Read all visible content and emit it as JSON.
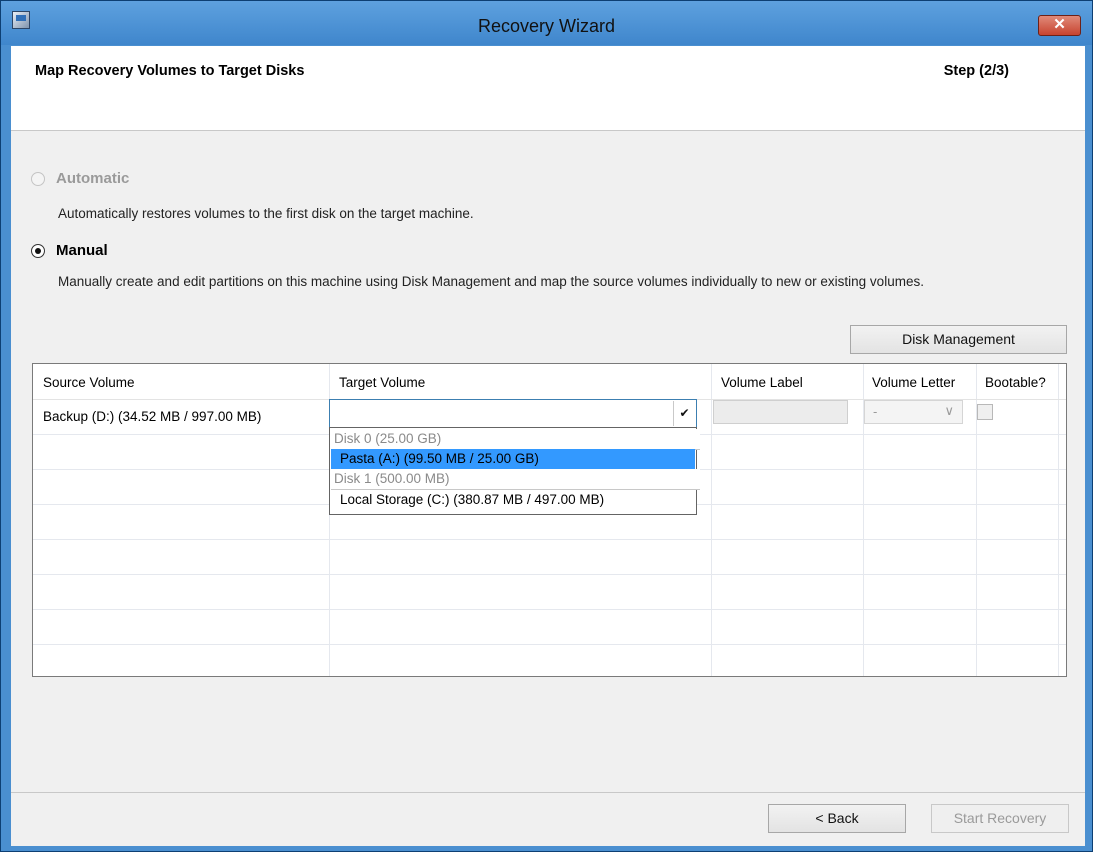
{
  "window": {
    "title": "Recovery Wizard",
    "close_glyph": "✕",
    "icon": "app-recovery-icon"
  },
  "header": {
    "title": "Map Recovery Volumes to Target Disks",
    "step": "Step (2/3)"
  },
  "mode": {
    "automatic": {
      "label": "Automatic",
      "description": "Automatically restores volumes to the first disk on the target machine.",
      "enabled": false,
      "selected": false
    },
    "manual": {
      "label": "Manual",
      "description": "Manually create and edit partitions on this machine using Disk Management and map the source volumes individually to new or existing volumes.",
      "enabled": true,
      "selected": true
    }
  },
  "disk_management_button": "Disk Management",
  "grid": {
    "columns": [
      "Source Volume",
      "Target Volume",
      "Volume Label",
      "Volume Letter",
      "Bootable?"
    ],
    "rows": [
      {
        "source_volume": "Backup (D:) (34.52 MB / 997.00 MB)",
        "target_volume": "",
        "volume_label": "",
        "volume_letter": "-",
        "bootable": false
      }
    ]
  },
  "target_dropdown": {
    "open": true,
    "items": [
      {
        "text": "Disk 0 (25.00 GB)",
        "kind": "header"
      },
      {
        "text": "Pasta (A:) (99.50 MB / 25.00 GB)",
        "kind": "option",
        "highlighted": true
      },
      {
        "text": "Disk 1 (500.00 MB)",
        "kind": "header"
      },
      {
        "text": "Local Storage (C:) (380.87 MB / 497.00 MB)",
        "kind": "option"
      }
    ]
  },
  "footer": {
    "back_label": "< Back",
    "start_label": "Start Recovery",
    "start_enabled": false
  },
  "colors": {
    "title_bar": "#4a8fd0",
    "selection": "#3399ff",
    "close_button": "#c7432f"
  }
}
